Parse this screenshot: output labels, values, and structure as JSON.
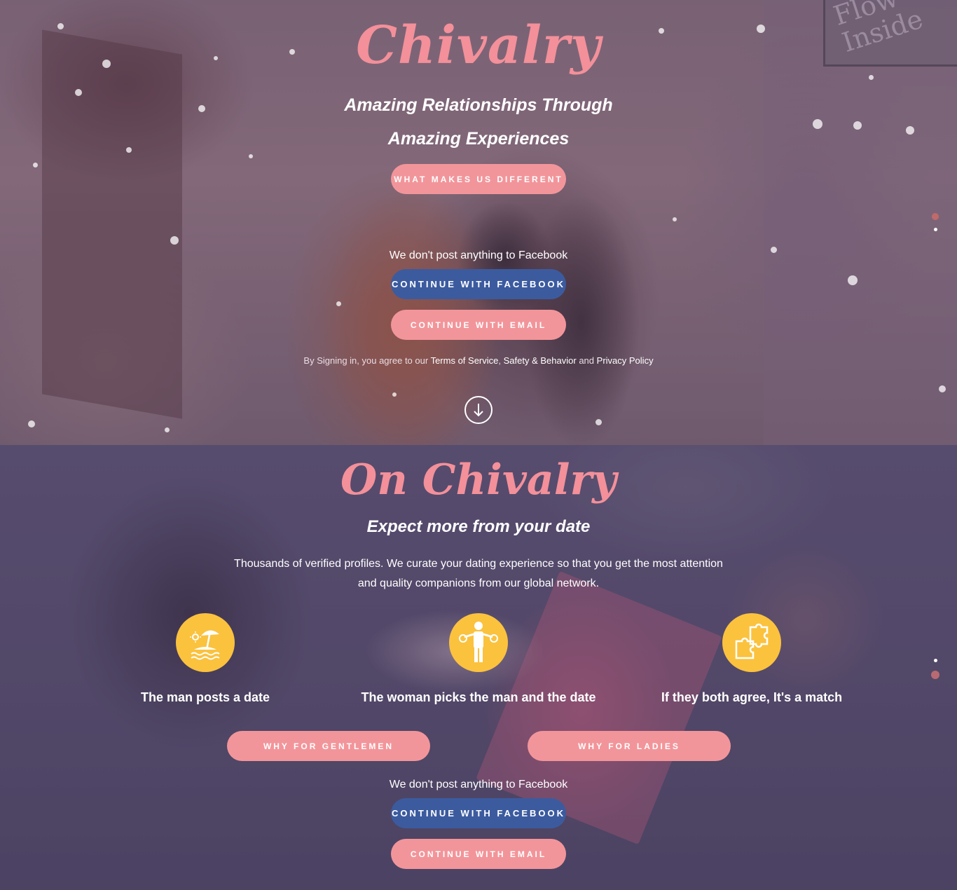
{
  "hero": {
    "brand": "Chivalry",
    "tagline_line1": "Amazing Relationships Through",
    "tagline_line2": "Amazing Experiences",
    "different_button": "WHAT MAKES US DIFFERENT",
    "sign_text": "Flow Inside"
  },
  "signup_top": {
    "note": "We don't post anything to Facebook",
    "facebook_button": "CONTINUE WITH FACEBOOK",
    "email_button": "CONTINUE WITH EMAIL",
    "legal_prefix": "By Signing in, you agree to our",
    "terms_link": "Terms of Service",
    "comma": ",",
    "safety_link": "Safety & Behavior",
    "and": "and",
    "privacy_link": "Privacy Policy"
  },
  "about": {
    "title": "On Chivalry",
    "subtitle": "Expect more from your date",
    "description": "Thousands of verified profiles. We curate your dating experience so that you get the most attention and quality companions from our global network.",
    "steps": [
      {
        "label": "The man posts a date",
        "icon": "beach-umbrella-icon"
      },
      {
        "label": "The woman picks the man and the date",
        "icon": "person-choosing-icon"
      },
      {
        "label": "If they both agree, It's a match",
        "icon": "puzzle-pieces-icon"
      }
    ],
    "gentlemen_button": "WHY FOR GENTLEMEN",
    "ladies_button": "WHY FOR LADIES"
  },
  "signup_bottom": {
    "note": "We don't post anything to Facebook",
    "facebook_button": "CONTINUE WITH FACEBOOK",
    "email_button": "CONTINUE WITH EMAIL"
  },
  "colors": {
    "brand_pink": "#f3909a",
    "button_pink": "#f2959a",
    "facebook_blue": "#3c5b9f",
    "icon_yellow": "#fbc23e"
  }
}
